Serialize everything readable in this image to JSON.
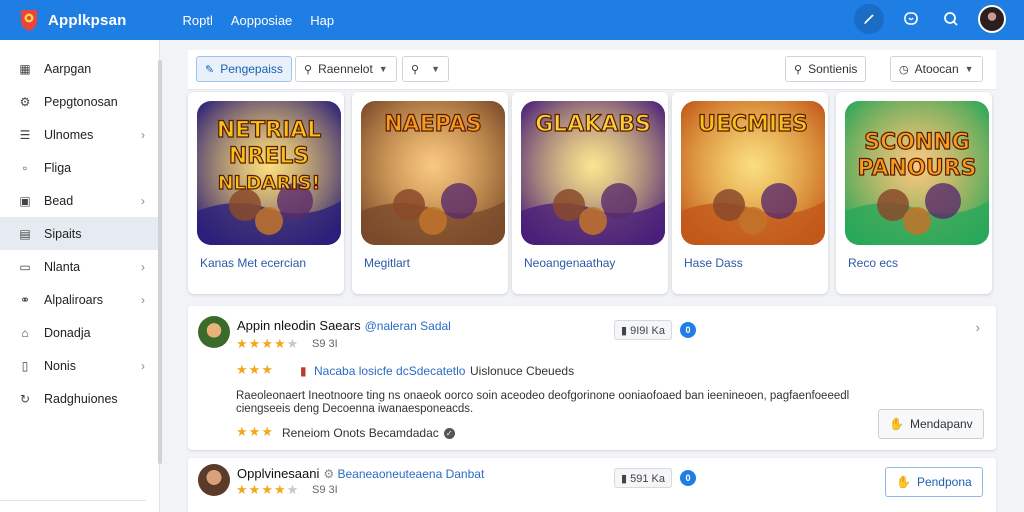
{
  "app": {
    "title": "Applkpsan"
  },
  "topnav": [
    "Roptl",
    "Aopposiae",
    "Hap"
  ],
  "topbar_icons": [
    "pen-icon",
    "chat-icon",
    "search-icon"
  ],
  "sidebar": {
    "items": [
      {
        "label": "Aarpgan",
        "icon": "grid-icon",
        "chevron": false,
        "active": false
      },
      {
        "label": "Pepgtonosan",
        "icon": "gear-icon",
        "chevron": false,
        "active": false
      },
      {
        "label": "Ulnomes",
        "icon": "list-icon",
        "chevron": true,
        "active": false
      },
      {
        "label": "Fliga",
        "icon": "tag-icon",
        "chevron": false,
        "active": false
      },
      {
        "label": "Bead",
        "icon": "box-icon",
        "chevron": true,
        "active": false
      },
      {
        "label": "Sipaits",
        "icon": "table-icon",
        "chevron": false,
        "active": true
      },
      {
        "label": "Nlanta",
        "icon": "window-icon",
        "chevron": true,
        "active": false
      },
      {
        "label": "Alpaliroars",
        "icon": "globe-icon",
        "chevron": true,
        "active": false
      },
      {
        "label": "Donadja",
        "icon": "home-icon",
        "chevron": false,
        "active": false
      },
      {
        "label": "Nonis",
        "icon": "doc-icon",
        "chevron": true,
        "active": false
      },
      {
        "label": "Radghuiones",
        "icon": "refresh-icon",
        "chevron": false,
        "active": false
      }
    ]
  },
  "filters": {
    "chip1": "Pengepaiss",
    "chip2": "Raennelot",
    "chip3": "",
    "chip4": "Sontienis",
    "chip5": "Atoocan"
  },
  "games": [
    {
      "name": "Kanas Met ecercian",
      "art_text": [
        "NETRIAL",
        "NRELS",
        "NLDARIS!"
      ],
      "bg": "#2b1f7a",
      "accent": "#f6c21c"
    },
    {
      "name": "Megitlart",
      "art_text": [
        "NAEPAS"
      ],
      "bg": "#7a4a2a",
      "accent": "#f39c1f"
    },
    {
      "name": "Neoangenaathay",
      "art_text": [
        "GLAKABS"
      ],
      "bg": "#4a1f7a",
      "accent": "#f6d03a"
    },
    {
      "name": "Hase Dass",
      "art_text": [
        "UECMIES"
      ],
      "bg": "#c2581a",
      "accent": "#f5c21c"
    },
    {
      "name": "Reco ecs",
      "art_text": [
        "SCONNG",
        "PANOURS"
      ],
      "bg": "#2aa85a",
      "accent": "#f39c1f"
    }
  ],
  "reviews": [
    {
      "title": "Appin nleodin Saears",
      "subtitle": "@naleran Sadal",
      "stars": 4,
      "rating_text": "S9 3I",
      "count": "▮ 9I9I Ka",
      "badge": "0",
      "line1_stars": 3,
      "line1_text": "Nacaba losicfe dcSdecatetlo",
      "line1_extra": "Uislonuce Cbeueds",
      "body": "Raeoleonaert Ineotnoore ting ns onaeok oorco soin aceodeo deofgorinone ooniaofoaed ban ieenineoen, pagfaenfoeeedl ciengseeis deng Decoenna iwanaesponeacds.",
      "line3_stars": 3,
      "line3_text": "Reneiom Onots Becamdadac",
      "action": "Mendapanv"
    },
    {
      "title": "Opplvinesaani",
      "subtitle": "Beaneaoneuteaena Danbat",
      "stars": 4,
      "rating_text": "S9 3I",
      "count": "▮ 591 Ka",
      "badge": "0",
      "action": "Pendpona"
    }
  ],
  "colors": {
    "topbar": "#1f7ee3",
    "accent": "#2a6cc4",
    "star": "#f2a81d"
  }
}
